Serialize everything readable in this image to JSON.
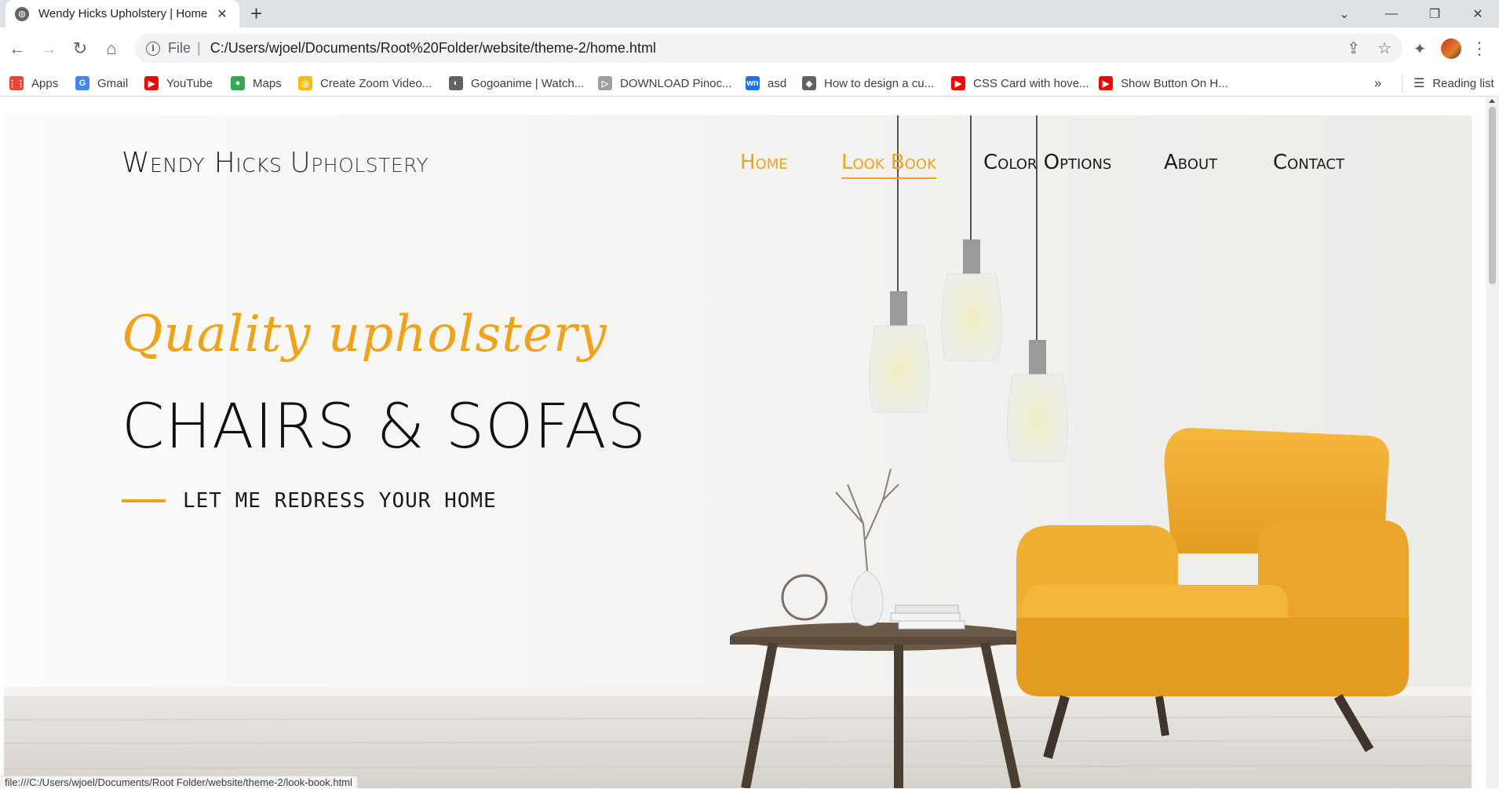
{
  "browser": {
    "tab": {
      "title": "Wendy Hicks Upholstery | Home",
      "close_glyph": "✕",
      "favicon": "globe-icon"
    },
    "new_tab_glyph": "+",
    "window_controls": {
      "search_tabs": "⌄",
      "minimize": "—",
      "restore": "❐",
      "close": "✕"
    },
    "nav": {
      "back": "←",
      "forward": "→",
      "reload": "↻",
      "home": "⌂"
    },
    "omnibox": {
      "info_glyph": "i",
      "scheme": "File",
      "separator": "|",
      "url": "C:/Users/wjoel/Documents/Root%20Folder/website/theme-2/home.html",
      "share_glyph": "⇪",
      "star_glyph": "☆"
    },
    "extensions_glyph": "✦",
    "menu_glyph": "⋮",
    "bookmarks": [
      {
        "label": "Apps",
        "icon": "apps-grid-icon",
        "color": "#ea4335",
        "glyph": "⋮⋮"
      },
      {
        "label": "Gmail",
        "icon": "google-icon",
        "color": "#4285f4",
        "glyph": "G"
      },
      {
        "label": "YouTube",
        "icon": "youtube-icon",
        "color": "#ff0000",
        "glyph": "▶"
      },
      {
        "label": "Maps",
        "icon": "maps-pin-icon",
        "color": "#34a853",
        "glyph": "●"
      },
      {
        "label": "Create Zoom Video...",
        "icon": "chrome-store-icon",
        "color": "#fbbc05",
        "glyph": "◎"
      },
      {
        "label": "Gogoanime | Watch...",
        "icon": "globe-icon",
        "color": "#5f6368",
        "glyph": "◐"
      },
      {
        "label": "DOWNLOAD Pinoc...",
        "icon": "video-icon",
        "color": "#9aa0a6",
        "glyph": "▷"
      },
      {
        "label": "asd",
        "icon": "wn-icon",
        "color": "#1a73e8",
        "glyph": "wn"
      },
      {
        "label": "How to design a cu...",
        "icon": "diamond-icon",
        "color": "#5f6368",
        "glyph": "◈"
      },
      {
        "label": "CSS Card with hove...",
        "icon": "youtube-icon",
        "color": "#ff0000",
        "glyph": "▶"
      },
      {
        "label": "Show Button On H...",
        "icon": "youtube-icon",
        "color": "#ff0000",
        "glyph": "▶"
      }
    ],
    "bookmarks_overflow": "»",
    "reading_list": "Reading list",
    "status_url": "file:///C:/Users/wjoel/Documents/Root Folder/website/theme-2/look-book.html"
  },
  "site": {
    "brand_first": "Wendy Hicks",
    "brand_second": "Upholstery",
    "nav": [
      {
        "label": "Home",
        "state": "accent"
      },
      {
        "label": "Look Book",
        "state": "active"
      },
      {
        "label": "Color Options",
        "state": "default"
      },
      {
        "label": "About",
        "state": "default"
      },
      {
        "label": "Contact",
        "state": "default"
      }
    ],
    "hero": {
      "tagline": "Quality upholstery",
      "headline": "CHAIRS & SOFAS",
      "subline": "LET ME REDRESS YOUR HOME"
    },
    "accent_color": "#f0a21d"
  }
}
